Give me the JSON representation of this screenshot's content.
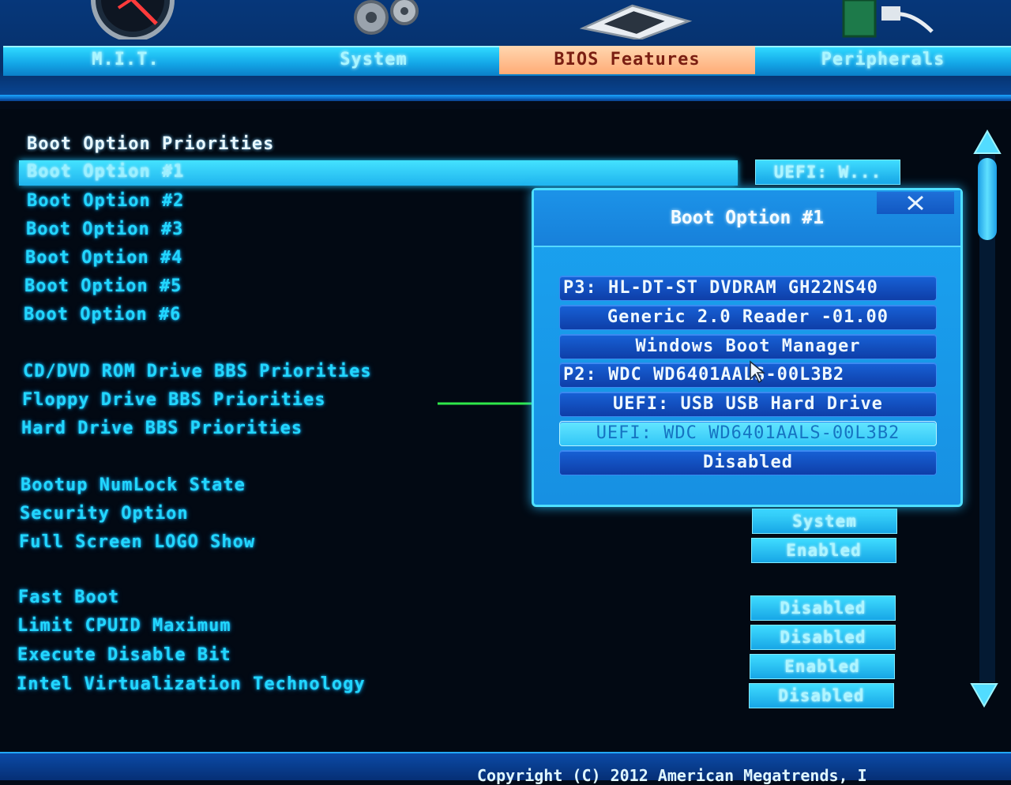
{
  "tabs": [
    {
      "label": "M.I.T.",
      "active": false
    },
    {
      "label": "System",
      "active": false
    },
    {
      "label": "BIOS Features",
      "active": true
    },
    {
      "label": "Peripherals",
      "active": false
    }
  ],
  "main": {
    "section_title": "Boot Option Priorities",
    "boot_options": [
      "Boot Option #1",
      "Boot Option #2",
      "Boot Option #3",
      "Boot Option #4",
      "Boot Option #5",
      "Boot Option #6"
    ],
    "bbs_items": [
      "CD/DVD ROM Drive BBS Priorities",
      "Floppy Drive BBS Priorities",
      "Hard Drive BBS Priorities"
    ],
    "misc_items": [
      "Bootup NumLock State",
      "Security Option",
      "Full Screen LOGO Show"
    ],
    "cpu_items": [
      "Fast Boot",
      "Limit CPUID Maximum",
      "Execute Disable Bit",
      "Intel Virtualization Technology"
    ],
    "values": {
      "boot_option_1": "UEFI: W...",
      "security_option": "System",
      "full_screen_logo": "Enabled",
      "fast_boot": "Disabled",
      "limit_cpuid": "Disabled",
      "execute_disable": "Enabled",
      "intel_vt": "Disabled"
    }
  },
  "popup": {
    "title": "Boot Option #1",
    "options": [
      "P3: HL-DT-ST DVDRAM GH22NS40",
      "Generic 2.0 Reader -01.00",
      "Windows Boot Manager",
      "P2: WDC WD6401AALS-00L3B2",
      "UEFI: USB USB Hard Drive",
      "UEFI: WDC WD6401AALS-00L3B2",
      "Disabled"
    ],
    "selected_index": 5
  },
  "footer": {
    "copyright": "Copyright (C) 2012 American Megatrends, I"
  },
  "colors": {
    "accent": "#22d6ff",
    "active_tab": "#ffab76",
    "popup_bg": "#1790e2",
    "arrow": "#2fe84a"
  }
}
